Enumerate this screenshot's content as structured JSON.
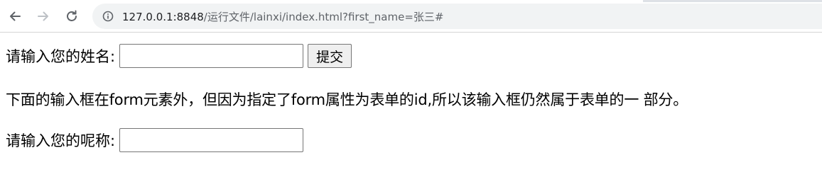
{
  "browser": {
    "url_host": "127.0.0.1:8848",
    "url_path": "/运行文件/lainxi/index.html?first_name=张三#",
    "icons": {
      "back": "back-arrow-icon",
      "forward": "forward-arrow-icon",
      "reload": "reload-icon",
      "info": "info-icon"
    }
  },
  "form": {
    "name_label": "请输入您的姓名:",
    "name_value": "",
    "submit_label": "提交"
  },
  "note": {
    "text": "下面的输入框在form元素外，但因为指定了form属性为表单的id,所以该输入框仍然属于表单的一 部分。"
  },
  "nickname": {
    "label": "请输入您的呢称:",
    "value": ""
  }
}
